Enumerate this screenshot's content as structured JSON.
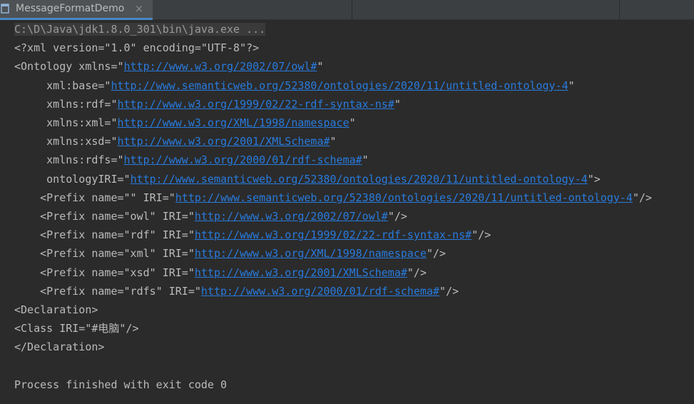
{
  "tab": {
    "title": "MessageFormatDemo",
    "close": "×"
  },
  "icons": {
    "tab": "console-icon",
    "close": "close-icon"
  },
  "colors": {
    "background": "#2b2b2b",
    "text": "#bbbbbb",
    "link": "#287bde",
    "tab_active": "#4e5254",
    "tab_underline": "#4a88c7"
  },
  "console": {
    "lines": [
      {
        "segments": [
          {
            "text": "C:\\D\\Java\\jdk1.8.0_301\\bin\\java.exe ...",
            "cmd": true
          }
        ]
      },
      {
        "segments": [
          {
            "text": "<?xml version=\"1.0\" encoding=\"UTF-8\"?>"
          }
        ]
      },
      {
        "segments": [
          {
            "text": "<Ontology xmlns=\""
          },
          {
            "text": "http://www.w3.org/2002/07/owl#",
            "link": true
          },
          {
            "text": "\""
          }
        ]
      },
      {
        "segments": [
          {
            "text": "     xml:base=\""
          },
          {
            "text": "http://www.semanticweb.org/52380/ontologies/2020/11/untitled-ontology-4",
            "link": true
          },
          {
            "text": "\""
          }
        ]
      },
      {
        "segments": [
          {
            "text": "     xmlns:rdf=\""
          },
          {
            "text": "http://www.w3.org/1999/02/22-rdf-syntax-ns#",
            "link": true
          },
          {
            "text": "\""
          }
        ]
      },
      {
        "segments": [
          {
            "text": "     xmlns:xml=\""
          },
          {
            "text": "http://www.w3.org/XML/1998/namespace",
            "link": true
          },
          {
            "text": "\""
          }
        ]
      },
      {
        "segments": [
          {
            "text": "     xmlns:xsd=\""
          },
          {
            "text": "http://www.w3.org/2001/XMLSchema#",
            "link": true
          },
          {
            "text": "\""
          }
        ]
      },
      {
        "segments": [
          {
            "text": "     xmlns:rdfs=\""
          },
          {
            "text": "http://www.w3.org/2000/01/rdf-schema#",
            "link": true
          },
          {
            "text": "\""
          }
        ]
      },
      {
        "segments": [
          {
            "text": "     ontologyIRI=\""
          },
          {
            "text": "http://www.semanticweb.org/52380/ontologies/2020/11/untitled-ontology-4",
            "link": true
          },
          {
            "text": "\">"
          }
        ]
      },
      {
        "segments": [
          {
            "text": "    <Prefix name=\"\" IRI=\""
          },
          {
            "text": "http://www.semanticweb.org/52380/ontologies/2020/11/untitled-ontology-4",
            "link": true
          },
          {
            "text": "\"/>"
          }
        ]
      },
      {
        "segments": [
          {
            "text": "    <Prefix name=\"owl\" IRI=\""
          },
          {
            "text": "http://www.w3.org/2002/07/owl#",
            "link": true
          },
          {
            "text": "\"/>"
          }
        ]
      },
      {
        "segments": [
          {
            "text": "    <Prefix name=\"rdf\" IRI=\""
          },
          {
            "text": "http://www.w3.org/1999/02/22-rdf-syntax-ns#",
            "link": true
          },
          {
            "text": "\"/>"
          }
        ]
      },
      {
        "segments": [
          {
            "text": "    <Prefix name=\"xml\" IRI=\""
          },
          {
            "text": "http://www.w3.org/XML/1998/namespace",
            "link": true
          },
          {
            "text": "\"/>"
          }
        ]
      },
      {
        "segments": [
          {
            "text": "    <Prefix name=\"xsd\" IRI=\""
          },
          {
            "text": "http://www.w3.org/2001/XMLSchema#",
            "link": true
          },
          {
            "text": "\"/>"
          }
        ]
      },
      {
        "segments": [
          {
            "text": "    <Prefix name=\"rdfs\" IRI=\""
          },
          {
            "text": "http://www.w3.org/2000/01/rdf-schema#",
            "link": true
          },
          {
            "text": "\"/>"
          }
        ]
      },
      {
        "segments": [
          {
            "text": "<Declaration>"
          }
        ]
      },
      {
        "segments": [
          {
            "text": "<Class IRI=\"#电脑\"/>"
          }
        ]
      },
      {
        "segments": [
          {
            "text": "</Declaration>"
          }
        ]
      },
      {
        "segments": [
          {
            "text": ""
          }
        ]
      },
      {
        "segments": [
          {
            "text": "Process finished with exit code 0"
          }
        ]
      }
    ]
  }
}
